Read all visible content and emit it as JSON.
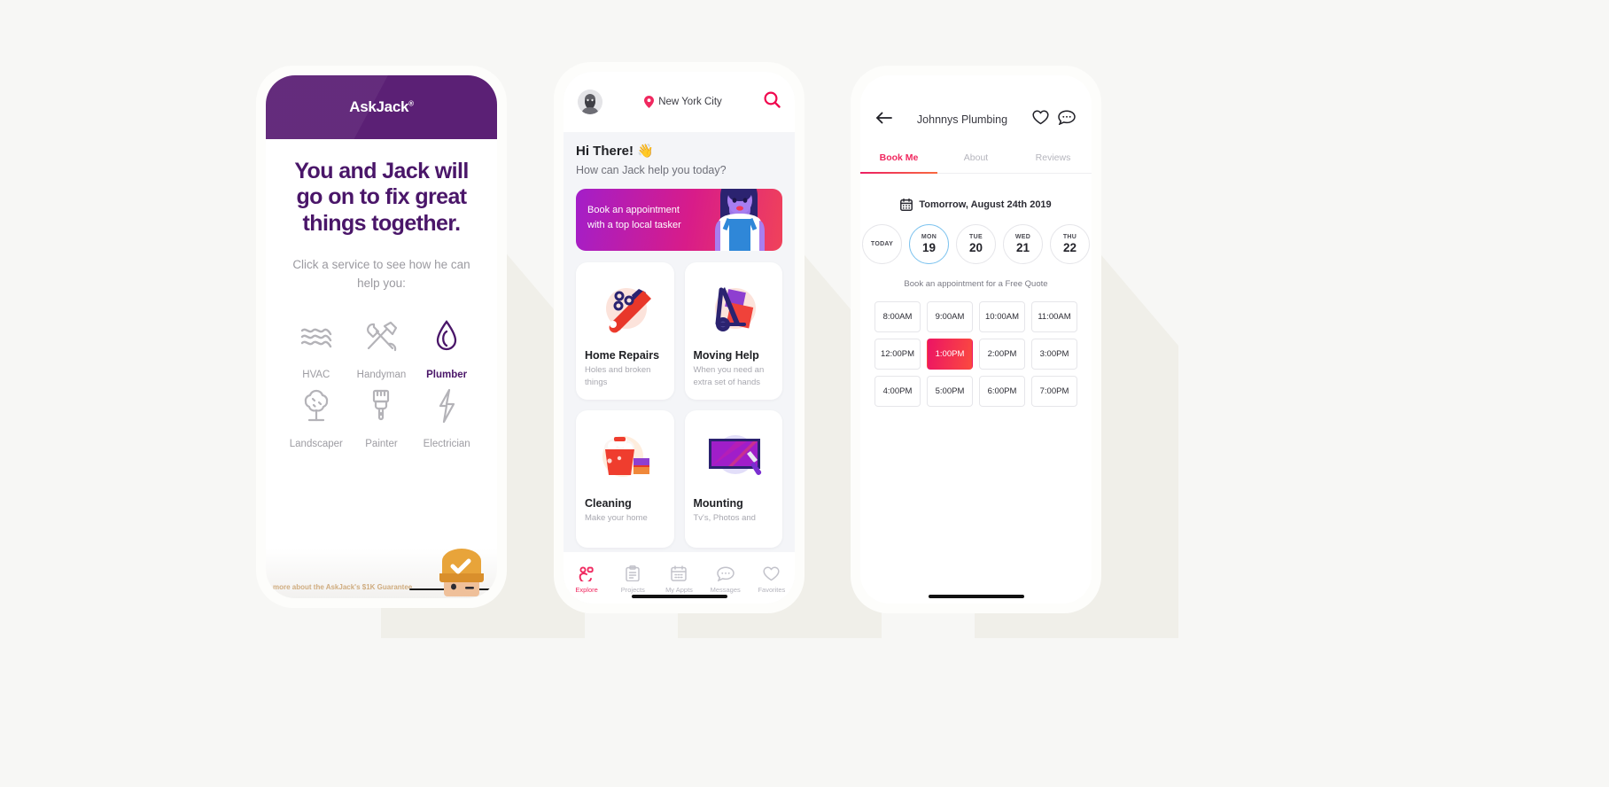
{
  "canvas": {
    "background": "#f7f7f5"
  },
  "phone1": {
    "brand": {
      "name": "AskJack",
      "mark": "®",
      "header_color": "#5b2075"
    },
    "headline": "You and Jack will go on to fix great things together.",
    "subhead": "Click a service to see how he can help you:",
    "services": [
      {
        "label": "HVAC",
        "icon": "waves-icon",
        "active": false
      },
      {
        "label": "Handyman",
        "icon": "hammer-wrench-icon",
        "active": false
      },
      {
        "label": "Plumber",
        "icon": "water-drop-icon",
        "active": true
      },
      {
        "label": "Landscaper",
        "icon": "tree-icon",
        "active": false
      },
      {
        "label": "Painter",
        "icon": "paintbrush-icon",
        "active": false
      },
      {
        "label": "Electrician",
        "icon": "lightning-bolt-icon",
        "active": false
      }
    ],
    "footer_note": "more about the AskJack's $1K Guarantee",
    "accent": "#4a1669"
  },
  "phone2": {
    "location": "New York City",
    "location_icon": "map-pin-icon",
    "search_icon": "search-icon",
    "avatar": "user-avatar",
    "greeting": "Hi There! 👋",
    "question": "How can Jack help you today?",
    "promo": {
      "line1": "Book an appointment",
      "line2": "with a top local tasker",
      "gradient_from": "#a31ec9",
      "gradient_to": "#f0425a"
    },
    "cards": [
      {
        "title": "Home Repairs",
        "subtitle": "Holes and broken things",
        "icon": "wrench-icon"
      },
      {
        "title": "Moving Help",
        "subtitle": "When you need an extra set of hands",
        "icon": "hand-truck-icon"
      },
      {
        "title": "Cleaning",
        "subtitle": "Make your home",
        "icon": "bucket-icon"
      },
      {
        "title": "Mounting",
        "subtitle": "Tv's, Photos and",
        "icon": "tv-mount-icon"
      }
    ],
    "nav": [
      {
        "label": "Explore",
        "icon": "explore-icon",
        "active": true
      },
      {
        "label": "Projects",
        "icon": "clipboard-icon",
        "active": false
      },
      {
        "label": "My Appts",
        "icon": "calendar-icon",
        "active": false
      },
      {
        "label": "Messages",
        "icon": "chat-bubble-icon",
        "active": false
      },
      {
        "label": "Favorites",
        "icon": "heart-icon",
        "active": false
      }
    ],
    "accent": "#f0285f"
  },
  "phone3": {
    "back_icon": "back-arrow-icon",
    "title": "Johnnys Plumbing",
    "favorite_icon": "heart-icon",
    "message_icon": "chat-bubble-icon",
    "tabs": [
      {
        "label": "Book Me",
        "active": true
      },
      {
        "label": "About",
        "active": false
      },
      {
        "label": "Reviews",
        "active": false
      }
    ],
    "date_icon": "calendar-icon",
    "date_label": "Tomorrow, August 24th 2019",
    "days": [
      {
        "dow": "TODAY",
        "num": "",
        "is_today": true,
        "selected": false
      },
      {
        "dow": "MON",
        "num": "19",
        "is_today": false,
        "selected": true
      },
      {
        "dow": "TUE",
        "num": "20",
        "is_today": false,
        "selected": false
      },
      {
        "dow": "WED",
        "num": "21",
        "is_today": false,
        "selected": false
      },
      {
        "dow": "THU",
        "num": "22",
        "is_today": false,
        "selected": false
      }
    ],
    "hint": "Book an appointment for a Free Quote",
    "slots": [
      {
        "time": "8:00AM",
        "selected": false
      },
      {
        "time": "9:00AM",
        "selected": false
      },
      {
        "time": "10:00AM",
        "selected": false
      },
      {
        "time": "11:00AM",
        "selected": false
      },
      {
        "time": "12:00PM",
        "selected": false
      },
      {
        "time": "1:00PM",
        "selected": true
      },
      {
        "time": "2:00PM",
        "selected": false
      },
      {
        "time": "3:00PM",
        "selected": false
      },
      {
        "time": "4:00PM",
        "selected": false
      },
      {
        "time": "5:00PM",
        "selected": false
      },
      {
        "time": "6:00PM",
        "selected": false
      },
      {
        "time": "7:00PM",
        "selected": false
      }
    ],
    "accent": "#f0285f",
    "selected_day_ring": "#7fc4ef"
  }
}
